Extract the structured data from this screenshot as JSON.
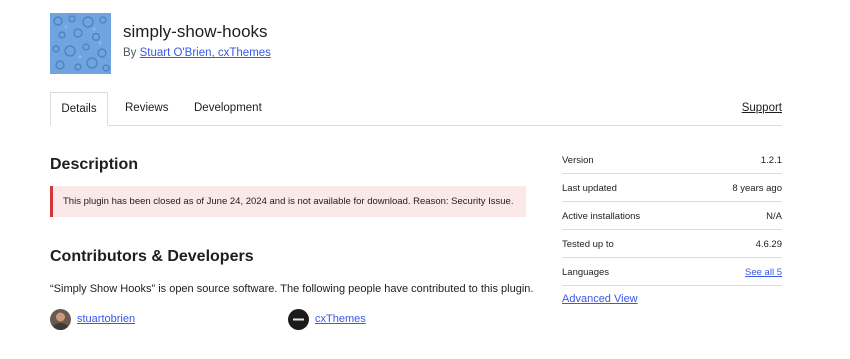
{
  "plugin": {
    "name": "simply-show-hooks",
    "by_prefix": "By ",
    "authors_link": "Stuart O'Brien, cxThemes"
  },
  "tabs": {
    "details": "Details",
    "reviews": "Reviews",
    "development": "Development",
    "support": "Support"
  },
  "description": {
    "heading": "Description",
    "notice": "This plugin has been closed as of June 24, 2024 and is not available for download. Reason: Security Issue."
  },
  "contributors": {
    "heading": "Contributors & Developers",
    "text": "“Simply Show Hooks” is open source software. The following people have contributed to this plugin.",
    "people": [
      {
        "name": "stuartobrien",
        "avatar": "person-avatar"
      },
      {
        "name": "cxThemes",
        "avatar": "cxthemes-logo-avatar"
      }
    ]
  },
  "meta": [
    {
      "key": "Version",
      "value": "1.2.1"
    },
    {
      "key": "Last updated",
      "value": "8 years ago"
    },
    {
      "key": "Active installations",
      "value": "N/A"
    },
    {
      "key": "Tested up to",
      "value": "4.6.29"
    },
    {
      "key": "Languages",
      "value": "See all 5"
    }
  ],
  "advanced_view": "Advanced View",
  "colors": {
    "link": "#3858e9",
    "notice_bg": "#fbe8e8",
    "notice_border": "#d63638",
    "icon_bg": "#6fa4e0"
  }
}
